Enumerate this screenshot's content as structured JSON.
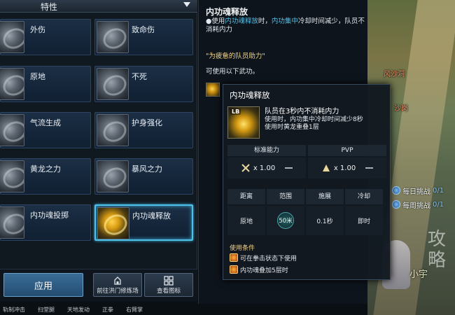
{
  "panel": {
    "title": "特性"
  },
  "skills": [
    {
      "name": "外伤"
    },
    {
      "name": "致命伤"
    },
    {
      "name": "原地"
    },
    {
      "name": "不死"
    },
    {
      "name": "气流生成"
    },
    {
      "name": "护身强化"
    },
    {
      "name": "黄龙之力"
    },
    {
      "name": "暴风之力"
    },
    {
      "name": "内功魂投掷"
    },
    {
      "name": "内功魂释放"
    }
  ],
  "buttons": {
    "apply": "应用",
    "trainer": "前往洪门修炼场",
    "view_icon": "查看图标"
  },
  "bottom_strip": [
    "轨制冲击",
    "扫堂腿",
    "天地发动",
    "正拳",
    "右臂掌"
  ],
  "detail": {
    "title": "内功魂释放",
    "bullet": "●",
    "desc_parts": [
      "使用",
      "内功魂释放",
      "时，",
      "内功集中",
      "冷却时间减少，队员不消耗内力"
    ],
    "quote": "\"为疲惫的队员助力\"",
    "learn": "可使用以下武功。"
  },
  "tooltip": {
    "title": "内功魂释放",
    "key": "LB",
    "lines": [
      "队员在3秒内不消耗内力",
      "使用时，内功集中冷却时间减少8秒",
      "使用时黄龙重叠1层"
    ],
    "stat_headers": [
      "标准能力",
      "PVP"
    ],
    "stat_values": [
      "x 1.00",
      "x 1.00"
    ],
    "grid_headers": [
      "距离",
      "范围",
      "施展",
      "冷却"
    ],
    "grid_values": [
      "原地",
      "50米",
      "0.1秒",
      "即时"
    ],
    "condition_title": "使用条件",
    "conditions": [
      "可在拳击状态下使用",
      "内功魂叠加5层时"
    ]
  },
  "game": {
    "map_labels": [
      "风沙洞",
      "沙岗"
    ],
    "challenges": [
      {
        "label": "每日挑战",
        "count": "0/1"
      },
      {
        "label": "每周挑战",
        "count": "0/1"
      }
    ],
    "watermark": {
      "seal": "攻略",
      "name": "小宇"
    }
  }
}
